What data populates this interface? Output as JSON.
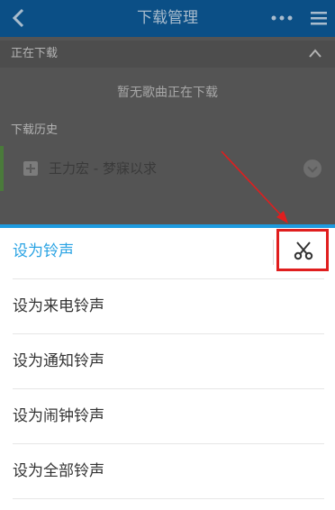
{
  "header": {
    "title": "下载管理",
    "back_icon": "back-arrow-icon",
    "more_icon": "more-dots-icon",
    "menu_icon": "hamburger-menu-icon"
  },
  "downloading": {
    "label": "正在下载",
    "empty_text": "暂无歌曲正在下载"
  },
  "history": {
    "label": "下载历史",
    "items": [
      {
        "title": "王力宏 - 梦寐以求"
      }
    ]
  },
  "sheet": {
    "accent_color": "#1e9be0",
    "options": [
      {
        "label": "设为铃声",
        "selected": true
      },
      {
        "label": "设为来电铃声"
      },
      {
        "label": "设为通知铃声"
      },
      {
        "label": "设为闹钟铃声"
      },
      {
        "label": "设为全部铃声"
      }
    ],
    "cut_icon": "scissors-icon"
  },
  "annotation": {
    "color": "#e01e1e"
  }
}
